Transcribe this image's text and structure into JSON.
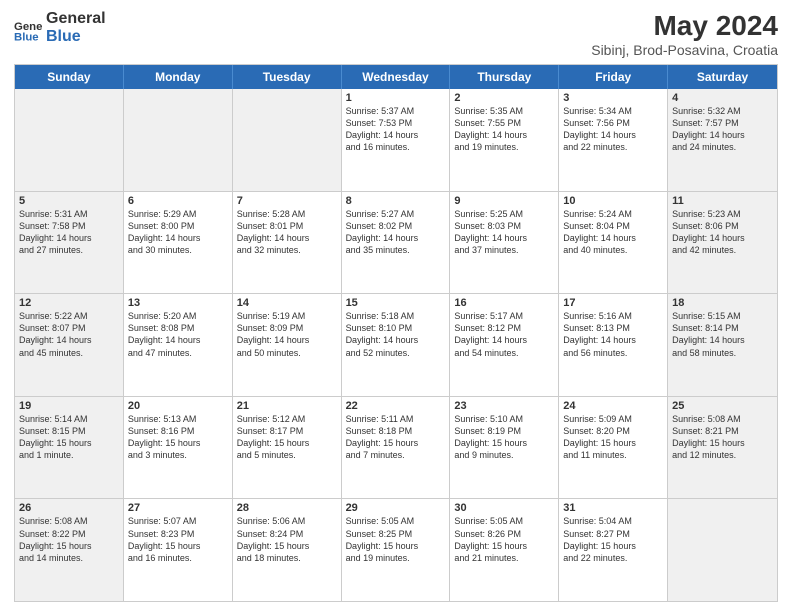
{
  "header": {
    "logo_general": "General",
    "logo_blue": "Blue",
    "month_year": "May 2024",
    "location": "Sibinj, Brod-Posavina, Croatia"
  },
  "days_of_week": [
    "Sunday",
    "Monday",
    "Tuesday",
    "Wednesday",
    "Thursday",
    "Friday",
    "Saturday"
  ],
  "rows": [
    {
      "cells": [
        {
          "day": "",
          "info": "",
          "shaded": true
        },
        {
          "day": "",
          "info": "",
          "shaded": true
        },
        {
          "day": "",
          "info": "",
          "shaded": true
        },
        {
          "day": "1",
          "info": "Sunrise: 5:37 AM\nSunset: 7:53 PM\nDaylight: 14 hours\nand 16 minutes.",
          "shaded": false
        },
        {
          "day": "2",
          "info": "Sunrise: 5:35 AM\nSunset: 7:55 PM\nDaylight: 14 hours\nand 19 minutes.",
          "shaded": false
        },
        {
          "day": "3",
          "info": "Sunrise: 5:34 AM\nSunset: 7:56 PM\nDaylight: 14 hours\nand 22 minutes.",
          "shaded": false
        },
        {
          "day": "4",
          "info": "Sunrise: 5:32 AM\nSunset: 7:57 PM\nDaylight: 14 hours\nand 24 minutes.",
          "shaded": true
        }
      ]
    },
    {
      "cells": [
        {
          "day": "5",
          "info": "Sunrise: 5:31 AM\nSunset: 7:58 PM\nDaylight: 14 hours\nand 27 minutes.",
          "shaded": true
        },
        {
          "day": "6",
          "info": "Sunrise: 5:29 AM\nSunset: 8:00 PM\nDaylight: 14 hours\nand 30 minutes.",
          "shaded": false
        },
        {
          "day": "7",
          "info": "Sunrise: 5:28 AM\nSunset: 8:01 PM\nDaylight: 14 hours\nand 32 minutes.",
          "shaded": false
        },
        {
          "day": "8",
          "info": "Sunrise: 5:27 AM\nSunset: 8:02 PM\nDaylight: 14 hours\nand 35 minutes.",
          "shaded": false
        },
        {
          "day": "9",
          "info": "Sunrise: 5:25 AM\nSunset: 8:03 PM\nDaylight: 14 hours\nand 37 minutes.",
          "shaded": false
        },
        {
          "day": "10",
          "info": "Sunrise: 5:24 AM\nSunset: 8:04 PM\nDaylight: 14 hours\nand 40 minutes.",
          "shaded": false
        },
        {
          "day": "11",
          "info": "Sunrise: 5:23 AM\nSunset: 8:06 PM\nDaylight: 14 hours\nand 42 minutes.",
          "shaded": true
        }
      ]
    },
    {
      "cells": [
        {
          "day": "12",
          "info": "Sunrise: 5:22 AM\nSunset: 8:07 PM\nDaylight: 14 hours\nand 45 minutes.",
          "shaded": true
        },
        {
          "day": "13",
          "info": "Sunrise: 5:20 AM\nSunset: 8:08 PM\nDaylight: 14 hours\nand 47 minutes.",
          "shaded": false
        },
        {
          "day": "14",
          "info": "Sunrise: 5:19 AM\nSunset: 8:09 PM\nDaylight: 14 hours\nand 50 minutes.",
          "shaded": false
        },
        {
          "day": "15",
          "info": "Sunrise: 5:18 AM\nSunset: 8:10 PM\nDaylight: 14 hours\nand 52 minutes.",
          "shaded": false
        },
        {
          "day": "16",
          "info": "Sunrise: 5:17 AM\nSunset: 8:12 PM\nDaylight: 14 hours\nand 54 minutes.",
          "shaded": false
        },
        {
          "day": "17",
          "info": "Sunrise: 5:16 AM\nSunset: 8:13 PM\nDaylight: 14 hours\nand 56 minutes.",
          "shaded": false
        },
        {
          "day": "18",
          "info": "Sunrise: 5:15 AM\nSunset: 8:14 PM\nDaylight: 14 hours\nand 58 minutes.",
          "shaded": true
        }
      ]
    },
    {
      "cells": [
        {
          "day": "19",
          "info": "Sunrise: 5:14 AM\nSunset: 8:15 PM\nDaylight: 15 hours\nand 1 minute.",
          "shaded": true
        },
        {
          "day": "20",
          "info": "Sunrise: 5:13 AM\nSunset: 8:16 PM\nDaylight: 15 hours\nand 3 minutes.",
          "shaded": false
        },
        {
          "day": "21",
          "info": "Sunrise: 5:12 AM\nSunset: 8:17 PM\nDaylight: 15 hours\nand 5 minutes.",
          "shaded": false
        },
        {
          "day": "22",
          "info": "Sunrise: 5:11 AM\nSunset: 8:18 PM\nDaylight: 15 hours\nand 7 minutes.",
          "shaded": false
        },
        {
          "day": "23",
          "info": "Sunrise: 5:10 AM\nSunset: 8:19 PM\nDaylight: 15 hours\nand 9 minutes.",
          "shaded": false
        },
        {
          "day": "24",
          "info": "Sunrise: 5:09 AM\nSunset: 8:20 PM\nDaylight: 15 hours\nand 11 minutes.",
          "shaded": false
        },
        {
          "day": "25",
          "info": "Sunrise: 5:08 AM\nSunset: 8:21 PM\nDaylight: 15 hours\nand 12 minutes.",
          "shaded": true
        }
      ]
    },
    {
      "cells": [
        {
          "day": "26",
          "info": "Sunrise: 5:08 AM\nSunset: 8:22 PM\nDaylight: 15 hours\nand 14 minutes.",
          "shaded": true
        },
        {
          "day": "27",
          "info": "Sunrise: 5:07 AM\nSunset: 8:23 PM\nDaylight: 15 hours\nand 16 minutes.",
          "shaded": false
        },
        {
          "day": "28",
          "info": "Sunrise: 5:06 AM\nSunset: 8:24 PM\nDaylight: 15 hours\nand 18 minutes.",
          "shaded": false
        },
        {
          "day": "29",
          "info": "Sunrise: 5:05 AM\nSunset: 8:25 PM\nDaylight: 15 hours\nand 19 minutes.",
          "shaded": false
        },
        {
          "day": "30",
          "info": "Sunrise: 5:05 AM\nSunset: 8:26 PM\nDaylight: 15 hours\nand 21 minutes.",
          "shaded": false
        },
        {
          "day": "31",
          "info": "Sunrise: 5:04 AM\nSunset: 8:27 PM\nDaylight: 15 hours\nand 22 minutes.",
          "shaded": false
        },
        {
          "day": "",
          "info": "",
          "shaded": true
        }
      ]
    }
  ]
}
